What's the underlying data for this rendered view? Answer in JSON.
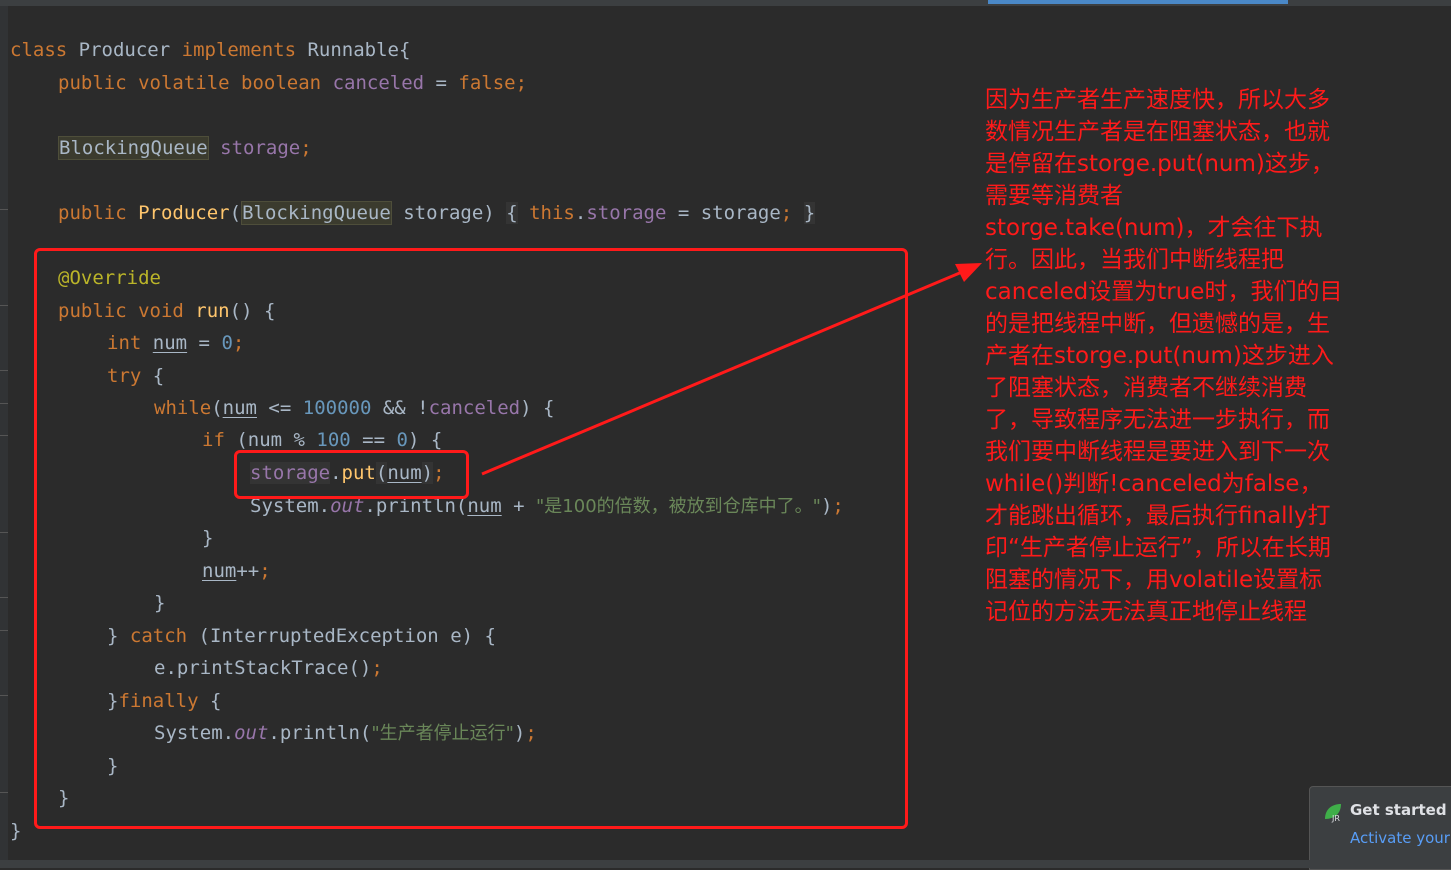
{
  "code": {
    "l1": {
      "kw1": "class",
      "name": "Producer",
      "kw2": "implements",
      "iface": "Runnable{"
    },
    "l2": {
      "kw": "public volatile boolean",
      "field": "canceled",
      "eq": " = ",
      "val": "false",
      "semi": ";"
    },
    "l3": {
      "type": "BlockingQueue",
      "field": "storage",
      "semi": ";"
    },
    "l4": {
      "kw": "public",
      "fn": "Producer",
      "p1": "(",
      "type": "BlockingQueue",
      "p2": " storage)",
      "b1": "{",
      "this": "this",
      "dot": ".",
      "field": "storage",
      "rest": " = storage",
      "semi": ";",
      "b2": "}"
    },
    "l5": {
      "ann": "@Override"
    },
    "l6": {
      "kw": "public void",
      "fn": "run",
      "rest": "() {"
    },
    "l7": {
      "kw": "int",
      "var": "num",
      "eq": " = ",
      "val": "0",
      "semi": ";"
    },
    "l8": {
      "kw": "try",
      "rest": " {"
    },
    "l9": {
      "kw": "while",
      "p1": "(",
      "var": "num",
      "op": " <= ",
      "val": "100000",
      "rest": " && !",
      "field": "canceled",
      "end": ") {"
    },
    "l10": {
      "kw": "if",
      "p1": " (num % ",
      "v1": "100",
      "p2": " == ",
      "v2": "0",
      "end": ") {"
    },
    "l11": {
      "field": "storage",
      "dot": ".",
      "fn": "put",
      "p1": "(",
      "var": "num",
      "end": ")",
      "semi": ";"
    },
    "l12": {
      "cls": "System.",
      "out": "out",
      "call": ".println(",
      "var": "num",
      "op": " + ",
      "str": "\"是100的倍数，被放到仓库中了。\"",
      "end": ")",
      "semi": ";"
    },
    "l13": {
      "text": "}"
    },
    "l14": {
      "var": "num",
      "op": "++",
      "semi": ";"
    },
    "l15": {
      "text": "}"
    },
    "l16": {
      "b": "} ",
      "kw": "catch",
      "rest": " (InterruptedException e) {"
    },
    "l17": {
      "text": "e.printStackTrace()",
      "semi": ";"
    },
    "l18": {
      "b": "}",
      "kw": "finally",
      "rest": " {"
    },
    "l19": {
      "cls": "System.",
      "out": "out",
      "call": ".println(",
      "str": "\"生产者停止运行\"",
      "end": ")",
      "semi": ";"
    },
    "l20": {
      "text": "}"
    },
    "l21": {
      "text": "}"
    },
    "l22": {
      "text": "}"
    }
  },
  "annotation": {
    "text": "因为生产者生产速度快，所以大多数情况生产者是在阻塞状态，也就是停留在storge.put(num)这步，需要等消费者storge.take(num)，才会往下执行。因此，当我们中断线程把canceled设置为true时，我们的目的是把线程中断，但遗憾的是，生产者在storge.put(num)这步进入了阻塞状态，消费者不继续消费了，导致程序无法进一步执行，而我们要中断线程是要进入到下一次while()判断!canceled为false，才能跳出循环，最后执行finally打印“生产者停止运行”，所以在长期阻塞的情况下，用volatile设置标记位的方法无法真正地停止线程",
    "color": "#ff1a1a"
  },
  "toast": {
    "title": "Get started wi",
    "link": "Activate your",
    "icon": "jrebel-leaf-icon"
  },
  "colors": {
    "background": "#2b2b2b",
    "keyword": "#cc7832",
    "field": "#9876aa",
    "string": "#6a8759",
    "number": "#6897bb",
    "annotation": "#bbb529",
    "function": "#ffc66d",
    "highlight_box": "#ff1a1a"
  }
}
